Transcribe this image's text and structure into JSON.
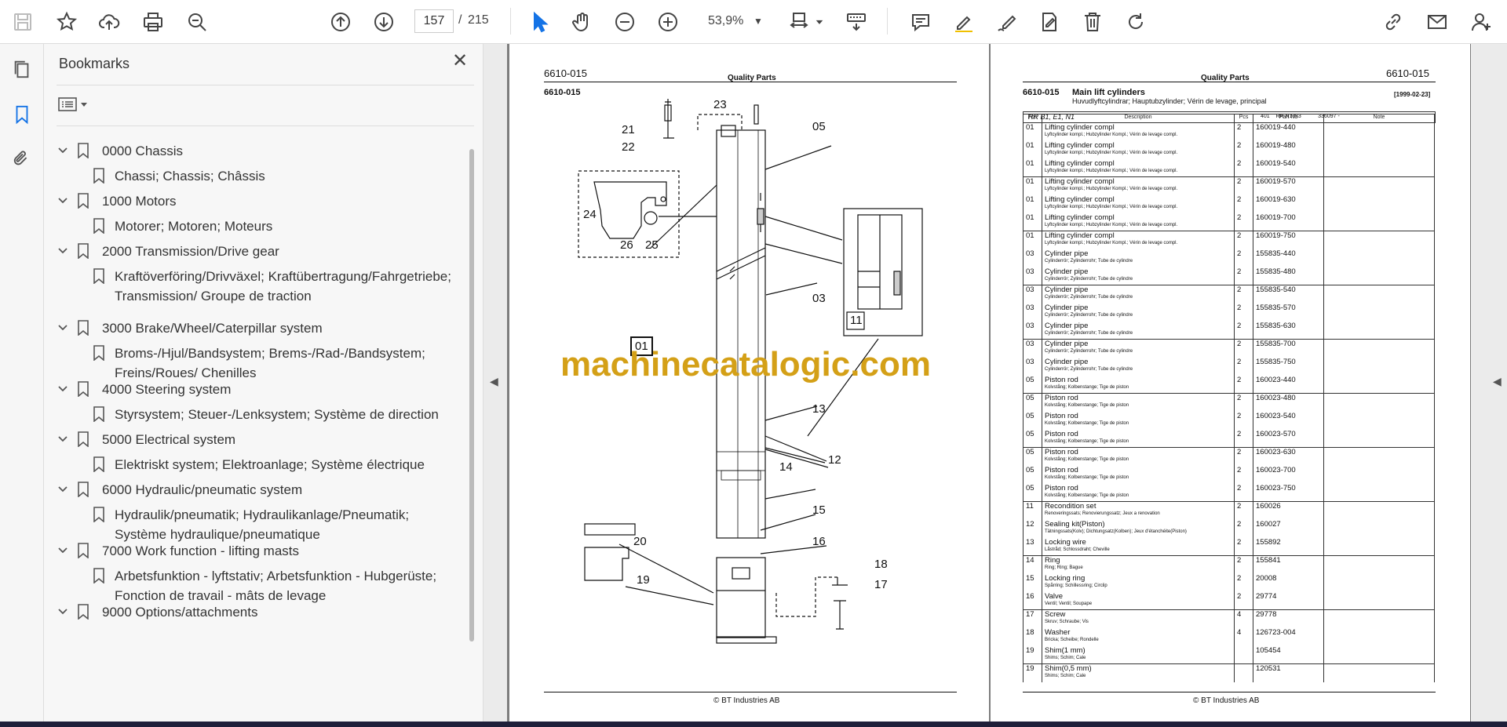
{
  "toolbar": {
    "page_current": "157",
    "page_separator": "/",
    "page_total": "215",
    "zoom": "53,9%"
  },
  "bookmarks_panel": {
    "title": "Bookmarks",
    "items": [
      {
        "label": "0000 Chassis",
        "level": 1
      },
      {
        "label": "Chassi; Chassis; Châssis",
        "level": 2
      },
      {
        "label": "1000 Motors",
        "level": 1
      },
      {
        "label": "Motorer; Motoren; Moteurs",
        "level": 2
      },
      {
        "label": "2000 Transmission/Drive gear",
        "level": 1
      },
      {
        "label": "Kraftöverföring/Drivväxel; Kraftübertragung/Fahrgetriebe; Transmission/ Groupe de traction",
        "level": 2
      },
      {
        "label": "3000 Brake/Wheel/Caterpillar system",
        "level": 1
      },
      {
        "label": "Broms-/Hjul/Bandsystem; Brems-/Rad-/Bandsystem; Freins/Roues/ Chenilles",
        "level": 2
      },
      {
        "label": "4000 Steering system",
        "level": 1
      },
      {
        "label": "Styrsystem; Steuer-/Lenksystem; Système de direction",
        "level": 2
      },
      {
        "label": "5000 Electrical system",
        "level": 1
      },
      {
        "label": "Elektriskt system; Elektroanlage; Système électrique",
        "level": 2
      },
      {
        "label": "6000 Hydraulic/pneumatic system",
        "level": 1
      },
      {
        "label": "Hydraulik/pneumatik; Hydraulikanlage/Pneumatik; Système hydraulique/pneumatique",
        "level": 2
      },
      {
        "label": "7000 Work function - lifting masts",
        "level": 1
      },
      {
        "label": "Arbetsfunktion - lyftstativ; Arbetsfunktion - Hubgerüste; Fonction de travail - mâts de levage",
        "level": 2
      },
      {
        "label": "9000 Options/attachments",
        "level": 1
      }
    ]
  },
  "page_left": {
    "code_top": "6610-015",
    "header": "Quality Parts",
    "code_sub": "6610-015",
    "callouts": [
      "21",
      "22",
      "23",
      "05",
      "24",
      "26",
      "25",
      "03",
      "01",
      "11",
      "13",
      "12",
      "14",
      "15",
      "16",
      "20",
      "19",
      "18",
      "17"
    ],
    "footer": "© BT Industries AB"
  },
  "watermark": "machinecatalogic.com",
  "page_right": {
    "code_top": "6610-015",
    "header": "Quality Parts",
    "section_code": "6610-015",
    "section_title": "Main lift cylinders",
    "section_subtitle": "Huvudlyftcylindrar; Hauptubzylinder; Vérin de levage, principal",
    "date": "[1999-02-23]",
    "model": "RR B1, E1, N1",
    "model_info": "401    RR N1-N3           336097 -",
    "columns": [
      "Pos",
      "Description",
      "Pcs",
      "Part No",
      "Note"
    ],
    "rows": [
      {
        "pos": "01",
        "desc": "Lifting cylinder compl",
        "sub": "Lyftcylinder kompl.; Hubzylinder Kompl.; Vérin de levage compl.",
        "pcs": "2",
        "part": "160019-440",
        "grp": true
      },
      {
        "pos": "01",
        "desc": "Lifting cylinder compl",
        "sub": "Lyftcylinder kompl.; Hubzylinder Kompl.; Vérin de levage compl.",
        "pcs": "2",
        "part": "160019-480",
        "grp": false
      },
      {
        "pos": "01",
        "desc": "Lifting cylinder compl",
        "sub": "Lyftcylinder kompl.; Hubzylinder Kompl.; Vérin de levage compl.",
        "pcs": "2",
        "part": "160019-540",
        "grp": false
      },
      {
        "pos": "01",
        "desc": "Lifting cylinder compl",
        "sub": "Lyftcylinder kompl.; Hubzylinder Kompl.; Vérin de levage compl.",
        "pcs": "2",
        "part": "160019-570",
        "grp": true
      },
      {
        "pos": "01",
        "desc": "Lifting cylinder compl",
        "sub": "Lyftcylinder kompl.; Hubzylinder Kompl.; Vérin de levage compl.",
        "pcs": "2",
        "part": "160019-630",
        "grp": false
      },
      {
        "pos": "01",
        "desc": "Lifting cylinder compl",
        "sub": "Lyftcylinder kompl.; Hubzylinder Kompl.; Vérin de levage compl.",
        "pcs": "2",
        "part": "160019-700",
        "grp": false
      },
      {
        "pos": "01",
        "desc": "Lifting cylinder compl",
        "sub": "Lyftcylinder kompl.; Hubzylinder Kompl.; Vérin de levage compl.",
        "pcs": "2",
        "part": "160019-750",
        "grp": true
      },
      {
        "pos": "03",
        "desc": "Cylinder pipe",
        "sub": "Cylinderrör; Zylinderrohr; Tube de cylindre",
        "pcs": "2",
        "part": "155835-440",
        "grp": false
      },
      {
        "pos": "03",
        "desc": "Cylinder pipe",
        "sub": "Cylinderrör; Zylinderrohr; Tube de cylindre",
        "pcs": "2",
        "part": "155835-480",
        "grp": false
      },
      {
        "pos": "03",
        "desc": "Cylinder pipe",
        "sub": "Cylinderrör; Zylinderrohr; Tube de cylindre",
        "pcs": "2",
        "part": "155835-540",
        "grp": true
      },
      {
        "pos": "03",
        "desc": "Cylinder pipe",
        "sub": "Cylinderrör; Zylinderrohr; Tube de cylindre",
        "pcs": "2",
        "part": "155835-570",
        "grp": false
      },
      {
        "pos": "03",
        "desc": "Cylinder pipe",
        "sub": "Cylinderrör; Zylinderrohr; Tube de cylindre",
        "pcs": "2",
        "part": "155835-630",
        "grp": false
      },
      {
        "pos": "03",
        "desc": "Cylinder pipe",
        "sub": "Cylinderrör; Zylinderrohr; Tube de cylindre",
        "pcs": "2",
        "part": "155835-700",
        "grp": true
      },
      {
        "pos": "03",
        "desc": "Cylinder pipe",
        "sub": "Cylinderrör; Zylinderrohr; Tube de cylindre",
        "pcs": "2",
        "part": "155835-750",
        "grp": false
      },
      {
        "pos": "05",
        "desc": "Piston rod",
        "sub": "Kolvstång; Kolbenstange; Tige de piston",
        "pcs": "2",
        "part": "160023-440",
        "grp": false
      },
      {
        "pos": "05",
        "desc": "Piston rod",
        "sub": "Kolvstång; Kolbenstange; Tige de piston",
        "pcs": "2",
        "part": "160023-480",
        "grp": true
      },
      {
        "pos": "05",
        "desc": "Piston rod",
        "sub": "Kolvstång; Kolbenstange; Tige de piston",
        "pcs": "2",
        "part": "160023-540",
        "grp": false
      },
      {
        "pos": "05",
        "desc": "Piston rod",
        "sub": "Kolvstång; Kolbenstange; Tige de piston",
        "pcs": "2",
        "part": "160023-570",
        "grp": false
      },
      {
        "pos": "05",
        "desc": "Piston rod",
        "sub": "Kolvstång; Kolbenstange; Tige de piston",
        "pcs": "2",
        "part": "160023-630",
        "grp": true
      },
      {
        "pos": "05",
        "desc": "Piston rod",
        "sub": "Kolvstång; Kolbenstange; Tige de piston",
        "pcs": "2",
        "part": "160023-700",
        "grp": false
      },
      {
        "pos": "05",
        "desc": "Piston rod",
        "sub": "Kolvstång; Kolbenstange; Tige de piston",
        "pcs": "2",
        "part": "160023-750",
        "grp": false
      },
      {
        "pos": "11",
        "desc": "Recondition set",
        "sub": "Renoveringssats; Renovierungssatz; Jeux a renovation",
        "pcs": "2",
        "part": "160026",
        "grp": true
      },
      {
        "pos": "12",
        "desc": "Sealing kit(Piston)",
        "sub": "Tätningssats(Kolv); Dichtungsatz(Kolben); Jeux d'étanchéite(Piston)",
        "pcs": "2",
        "part": "160027",
        "grp": false
      },
      {
        "pos": "13",
        "desc": "Locking wire",
        "sub": "Låstråd; Schlossdraht; Cheville",
        "pcs": "2",
        "part": "155892",
        "grp": false
      },
      {
        "pos": "14",
        "desc": "Ring",
        "sub": "Ring; Ring; Bague",
        "pcs": "2",
        "part": "155841",
        "grp": true
      },
      {
        "pos": "15",
        "desc": "Locking ring",
        "sub": "Spårring; Schillessring; Circlip",
        "pcs": "2",
        "part": "20008",
        "grp": false
      },
      {
        "pos": "16",
        "desc": "Valve",
        "sub": "Ventil; Ventil; Soupape",
        "pcs": "2",
        "part": "29774",
        "grp": false
      },
      {
        "pos": "17",
        "desc": "Screw",
        "sub": "Skruv; Schraube; Vis",
        "pcs": "4",
        "part": "29778",
        "grp": true
      },
      {
        "pos": "18",
        "desc": "Washer",
        "sub": "Bricka; Scheibe; Rondelle",
        "pcs": "4",
        "part": "126723-004",
        "grp": false
      },
      {
        "pos": "19",
        "desc": "Shim(1 mm)",
        "sub": "Shims; Schim; Cale",
        "pcs": "",
        "part": "105454",
        "grp": false
      },
      {
        "pos": "19",
        "desc": "Shim(0,5 mm)",
        "sub": "Shims; Schim; Cale",
        "pcs": "",
        "part": "120531",
        "grp": true
      }
    ],
    "footer": "© BT Industries AB"
  }
}
